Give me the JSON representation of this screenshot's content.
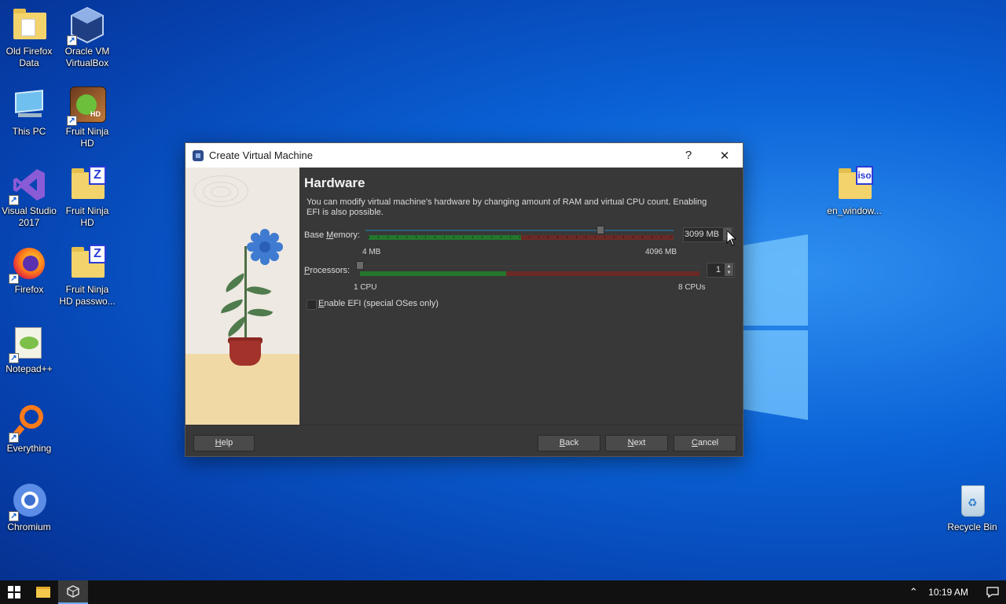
{
  "desktop": {
    "icons_left": [
      {
        "label": "Old Firefox Data",
        "icon": "folder-icon"
      },
      {
        "label": "Oracle VM VirtualBox",
        "icon": "virtualbox-icon"
      },
      {
        "label": "This PC",
        "icon": "computer-icon"
      },
      {
        "label": "Fruit Ninja HD",
        "icon": "fruit-ninja-icon"
      },
      {
        "label": "Visual Studio 2017",
        "icon": "visual-studio-icon"
      },
      {
        "label": "Fruit Ninja HD",
        "icon": "zip-folder-icon"
      },
      {
        "label": "Firefox",
        "icon": "firefox-icon"
      },
      {
        "label": "Fruit Ninja HD passwo...",
        "icon": "zip-folder-icon"
      },
      {
        "label": "Notepad++",
        "icon": "notepad-plus-plus-icon"
      },
      {
        "label": "Everything",
        "icon": "everything-search-icon"
      },
      {
        "label": "Chromium",
        "icon": "chromium-icon"
      }
    ],
    "iso_icon": {
      "label": "en_window...",
      "badge": "iso"
    },
    "recycle_bin": {
      "label": "Recycle Bin"
    }
  },
  "dialog": {
    "title": "Create Virtual Machine",
    "help_glyph": "?",
    "close_glyph": "✕",
    "heading": "Hardware",
    "description": "You can modify virtual machine's hardware by changing amount of RAM and virtual CPU count. Enabling EFI is also possible.",
    "memory": {
      "label_pre": "Base ",
      "label_mnemonic": "M",
      "label_post": "emory:",
      "value": "3099 MB",
      "min_label": "4 MB",
      "max_label": "4096 MB",
      "slider_fraction": 0.76,
      "recommended_fraction": 0.5
    },
    "processors": {
      "label_pre": "",
      "label_mnemonic": "P",
      "label_post": "rocessors:",
      "value": "1",
      "min_label": "1 CPU",
      "max_label": "8 CPUs",
      "slider_fraction": 0.0,
      "recommended_fraction": 0.43
    },
    "efi": {
      "label_mnemonic": "E",
      "label_post": "nable EFI (special OSes only)",
      "checked": false
    },
    "buttons": {
      "help": {
        "mnemonic": "H",
        "rest": "elp"
      },
      "back": {
        "mnemonic": "B",
        "rest": "ack"
      },
      "next": {
        "mnemonic": "N",
        "rest": "ext"
      },
      "cancel": {
        "mnemonic": "C",
        "rest": "ancel"
      }
    }
  },
  "taskbar": {
    "clock": "10:19 AM",
    "apps": [
      "file-explorer-icon",
      "virtualbox-icon"
    ]
  }
}
